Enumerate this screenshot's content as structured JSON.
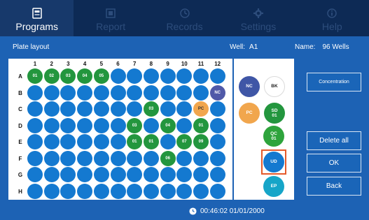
{
  "tabs": [
    {
      "label": "Programs",
      "icon": "programs-icon",
      "active": true
    },
    {
      "label": "Report",
      "icon": "report-icon",
      "active": false
    },
    {
      "label": "Records",
      "icon": "records-icon",
      "active": false
    },
    {
      "label": "Settings",
      "icon": "settings-icon",
      "active": false
    },
    {
      "label": "Help",
      "icon": "help-icon",
      "active": false
    }
  ],
  "info": {
    "title": "Plate layout",
    "well_label": "Well:",
    "well_value": "A1",
    "name_label": "Name:",
    "name_value": "96 Wells"
  },
  "plate": {
    "columns": [
      "1",
      "2",
      "3",
      "4",
      "5",
      "6",
      "7",
      "8",
      "9",
      "10",
      "11",
      "12"
    ],
    "rows": [
      "A",
      "B",
      "C",
      "D",
      "E",
      "F",
      "G",
      "H"
    ],
    "wells": [
      [
        "01",
        "02",
        "03",
        "04",
        "05",
        "",
        "",
        "",
        "",
        "",
        "",
        ""
      ],
      [
        "",
        "",
        "",
        "",
        "",
        "",
        "",
        "",
        "",
        "",
        "",
        "NC"
      ],
      [
        "",
        "",
        "",
        "",
        "",
        "",
        "",
        "03",
        "",
        "",
        "PC",
        ""
      ],
      [
        "",
        "",
        "",
        "",
        "",
        "",
        "03",
        "",
        "04",
        "",
        "01",
        ""
      ],
      [
        "",
        "",
        "",
        "",
        "",
        "",
        "01",
        "01",
        "",
        "07",
        "09",
        ""
      ],
      [
        "",
        "",
        "",
        "",
        "",
        "",
        "",
        "",
        "06",
        "",
        "",
        ""
      ],
      [
        "",
        "",
        "",
        "",
        "",
        "",
        "",
        "",
        "",
        "",
        "",
        ""
      ],
      [
        "",
        "",
        "",
        "",
        "",
        "",
        "",
        "",
        "",
        "",
        "",
        ""
      ]
    ]
  },
  "palette": [
    {
      "id": "nc",
      "label": "NC"
    },
    {
      "id": "bk",
      "label": "BK"
    },
    {
      "id": "pc",
      "label": "PC"
    },
    {
      "id": "sd",
      "label": "SD\n01"
    },
    {
      "id": "qc",
      "label": "QC\n01"
    },
    {
      "id": "ud",
      "label": "UD",
      "selected": true
    },
    {
      "id": "ep",
      "label": "EP"
    }
  ],
  "buttons": {
    "concentration": "Concentration",
    "delete_all": "Delete all",
    "ok": "OK",
    "back": "Back"
  },
  "footer": {
    "time": "00:46:02",
    "date": "01/01/2000"
  },
  "colors": {
    "background": "#1d62b4",
    "tab_bar": "#0d2a55",
    "empty_well": "#1479d0",
    "sample_well": "#23963e",
    "pc_well": "#f1a64d",
    "nc_well": "#5059a8",
    "selection_frame": "#e55a2b"
  }
}
